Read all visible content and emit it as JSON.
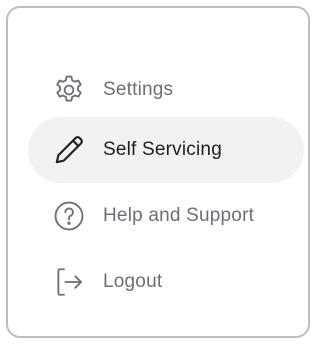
{
  "menu": {
    "items": [
      {
        "label": "Settings",
        "icon": "gear-icon",
        "active": false
      },
      {
        "label": "Self Servicing",
        "icon": "pencil-icon",
        "active": true
      },
      {
        "label": "Help and Support",
        "icon": "question-circle-icon",
        "active": false
      },
      {
        "label": "Logout",
        "icon": "logout-icon",
        "active": false
      }
    ]
  },
  "colors": {
    "active_background": "#f2f2f4",
    "active_text": "#1e1f24",
    "inactive_text": "#6b6f78",
    "border": "#bdbdc2"
  }
}
